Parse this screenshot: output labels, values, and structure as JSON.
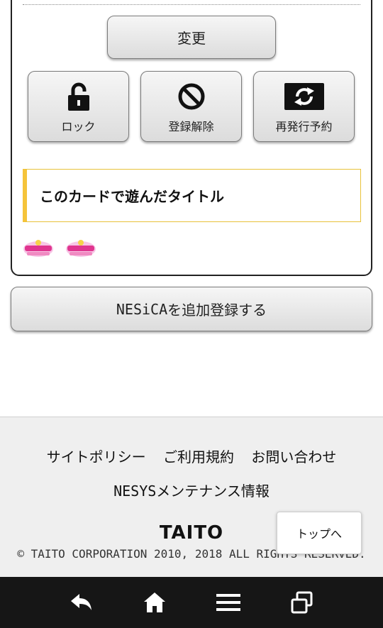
{
  "card_panel": {
    "change_label": "変更",
    "actions": [
      {
        "label": "ロック",
        "icon": "unlocked-padlock-icon"
      },
      {
        "label": "登録解除",
        "icon": "prohibited-icon"
      },
      {
        "label": "再発行予約",
        "icon": "reissue-arrows-icon"
      }
    ],
    "titles_heading": "このカードで遊んだタイトル",
    "played_titles": [
      {
        "icon": "game-title-logo-icon"
      },
      {
        "icon": "game-title-logo-icon"
      }
    ]
  },
  "add_card": {
    "label_prefix": "NESiCA",
    "label_suffix": "を追加登録する"
  },
  "footer": {
    "links": [
      "サイトポリシー",
      "ご利用規約",
      "お問い合わせ"
    ],
    "maintenance_prefix": "NESYS",
    "maintenance_suffix": "メンテナンス情報",
    "logo_text": "TAITO",
    "copyright": "© TAITO CORPORATION 2010, 2018 ALL RIGHTS RESERVED.",
    "top_button": "トップへ"
  },
  "nav_bar": {
    "buttons": [
      "back-icon",
      "home-icon",
      "menu-icon",
      "recent-apps-icon"
    ]
  },
  "colors": {
    "accent_yellow": "#f5c43a",
    "nav_background": "#161616",
    "footer_background": "#efefef"
  }
}
